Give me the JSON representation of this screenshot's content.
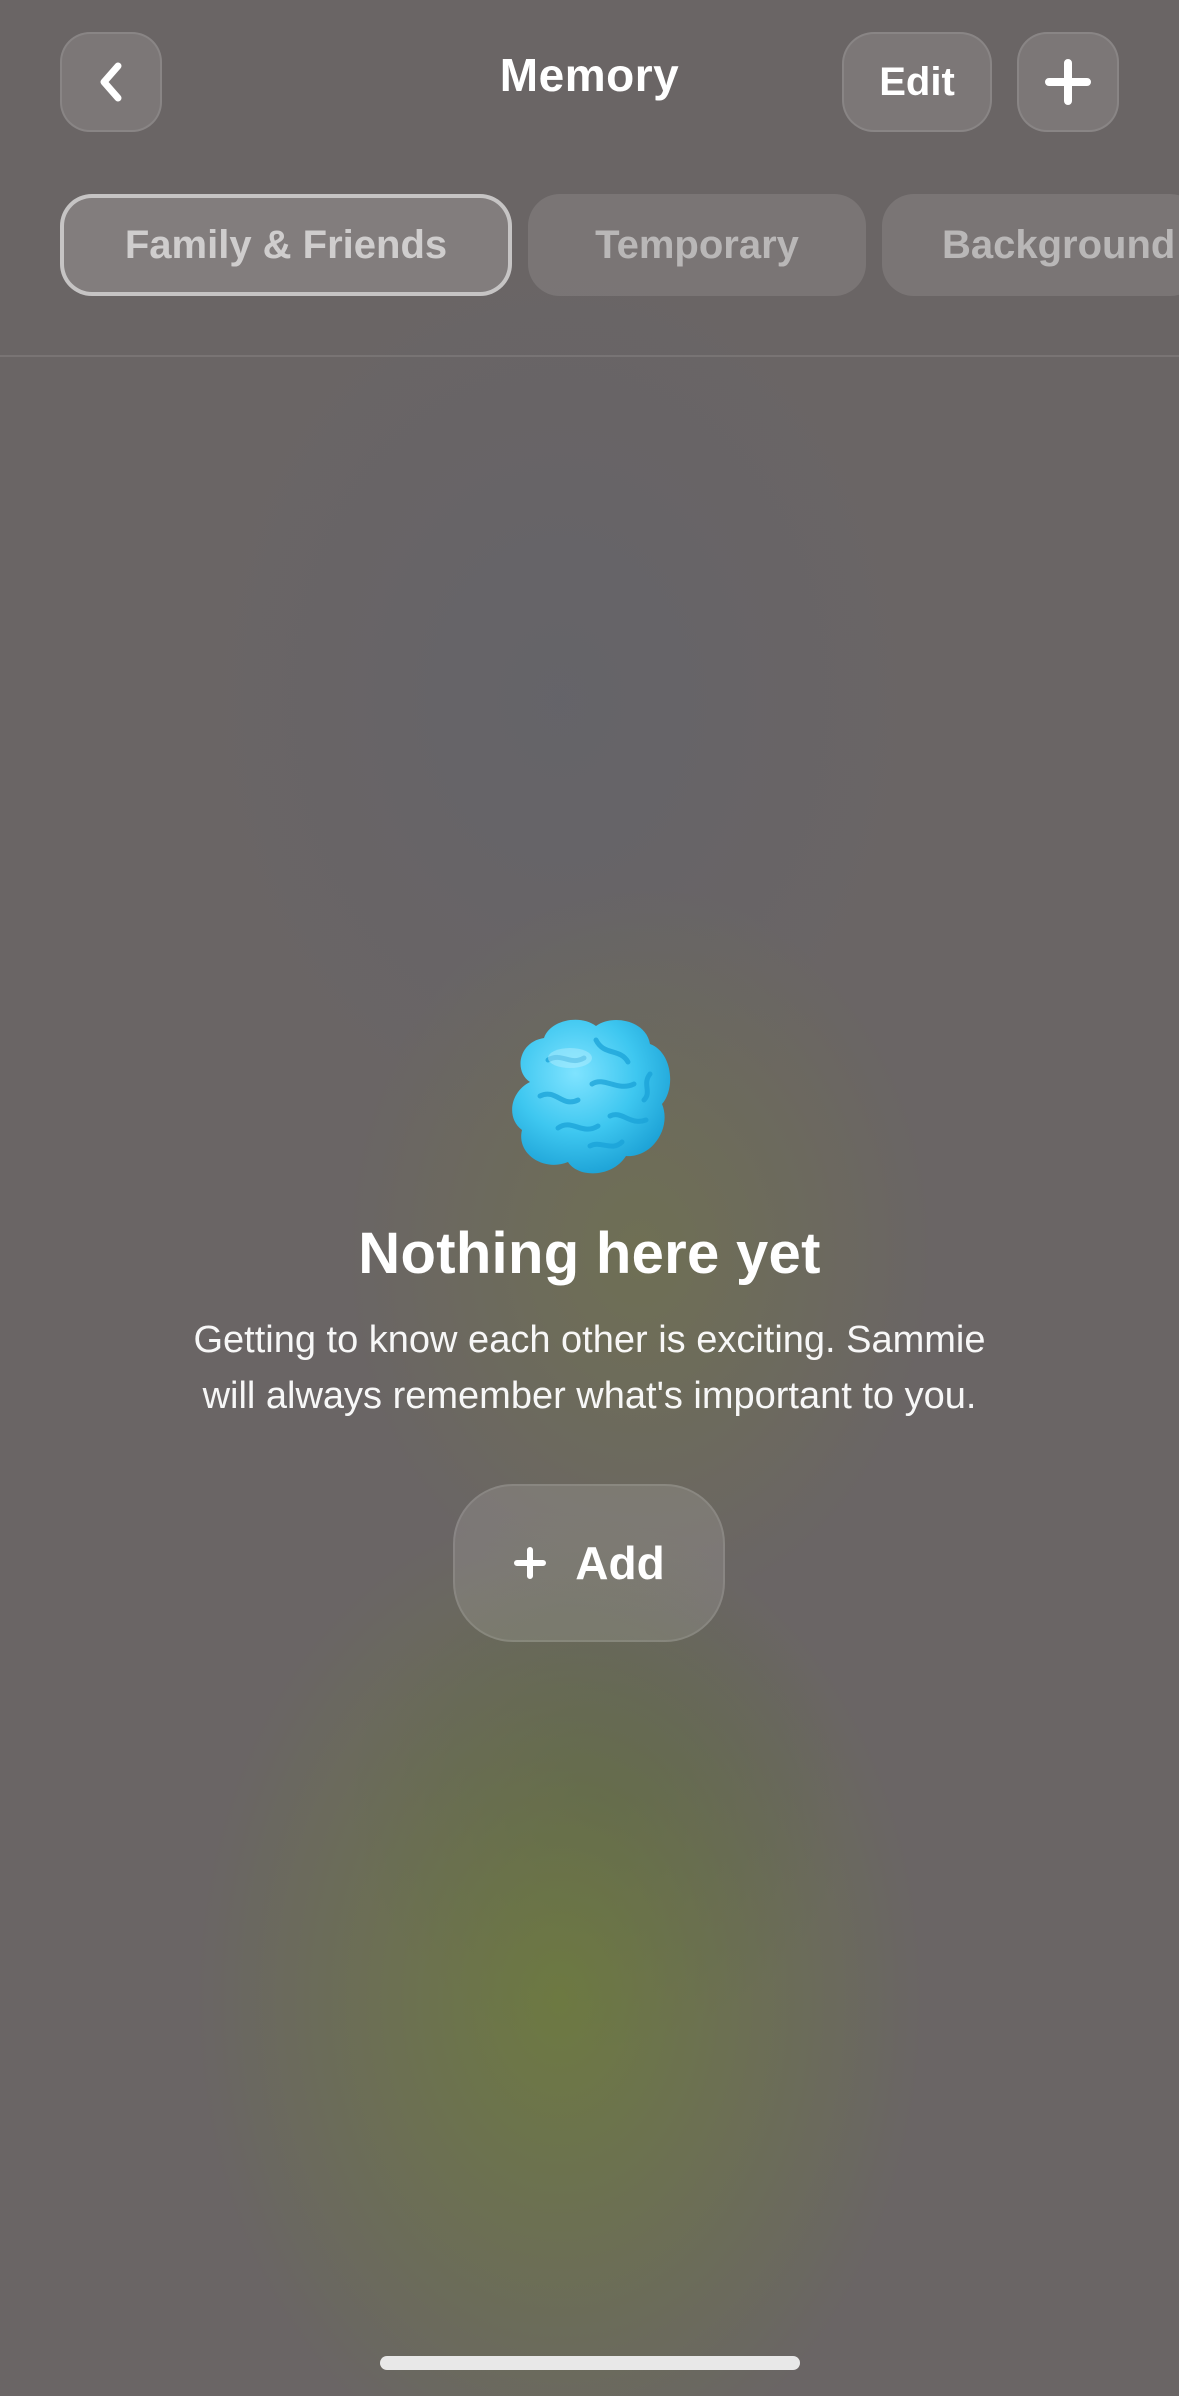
{
  "header": {
    "title": "Memory",
    "edit_label": "Edit",
    "back_icon": "chevron-left-icon",
    "add_icon": "plus-icon"
  },
  "tabs": [
    {
      "label": "Family & Friends",
      "active": true
    },
    {
      "label": "Temporary",
      "active": false
    },
    {
      "label": "Background",
      "active": false
    }
  ],
  "empty_state": {
    "icon": "brain-icon",
    "icon_color": "#3ec7f0",
    "title": "Nothing here yet",
    "line1": "Getting to know each other is exciting. Sammie",
    "line2": "will always remember what's important to you.",
    "add_label": "Add"
  }
}
